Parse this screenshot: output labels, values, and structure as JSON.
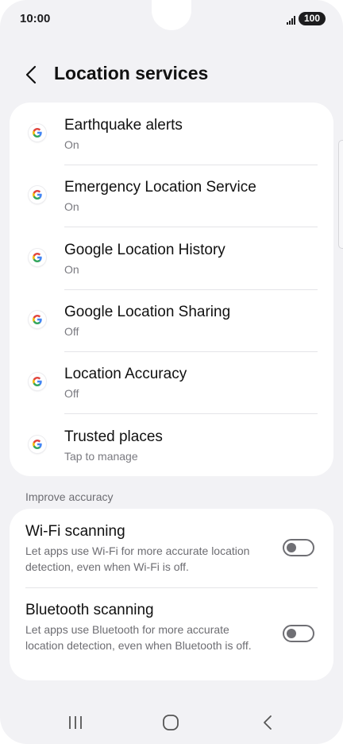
{
  "status_bar": {
    "time": "10:00",
    "battery": "100",
    "signal_icon": "signal-bars-icon"
  },
  "header": {
    "back_icon": "chevron-left-icon",
    "title": "Location services"
  },
  "services": [
    {
      "title": "Earthquake alerts",
      "status": "On",
      "icon": "google-g-icon"
    },
    {
      "title": "Emergency Location Service",
      "status": "On",
      "icon": "google-g-icon"
    },
    {
      "title": "Google Location History",
      "status": "On",
      "icon": "google-g-icon"
    },
    {
      "title": "Google Location Sharing",
      "status": "Off",
      "icon": "google-g-icon"
    },
    {
      "title": "Location Accuracy",
      "status": "Off",
      "icon": "google-g-icon"
    },
    {
      "title": "Trusted places",
      "status": "Tap to manage",
      "icon": "google-g-icon"
    }
  ],
  "improve_accuracy": {
    "header": "Improve accuracy",
    "items": [
      {
        "title": "Wi-Fi scanning",
        "description": "Let apps use Wi-Fi for more accurate location detection, even when Wi-Fi is off.",
        "enabled": false
      },
      {
        "title": "Bluetooth scanning",
        "description": "Let apps use Bluetooth for more accurate location detection, even when Bluetooth is off.",
        "enabled": false
      }
    ]
  },
  "nav_bar": {
    "recents_icon": "recents-icon",
    "home_icon": "home-icon",
    "back_icon": "back-icon"
  },
  "colors": {
    "background": "#f2f2f5",
    "card": "#ffffff",
    "toggle_off": "#6f6f74"
  }
}
